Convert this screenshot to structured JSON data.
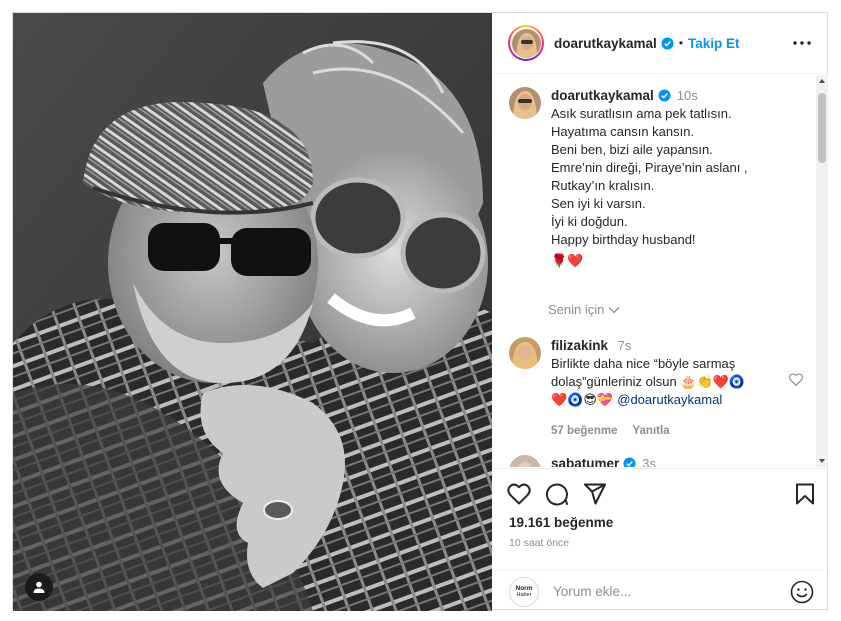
{
  "post": {
    "username": "doarutkaykamal",
    "follow_label": "Takip Et",
    "separator": "•"
  },
  "caption": {
    "username": "doarutkaykamal",
    "time": "10s",
    "lines": [
      "Asık suratlısın ama pek tatlısın.",
      "Hayatıma cansın kansın.",
      "Beni ben, bizi aile yapansın.",
      "Emre’nin direği, Piraye’nin aslanı ,",
      "Rutkay’ın kralısın.",
      "Sen iyi ki varsın.",
      "İyi ki doğdun.",
      "Happy birthday husband!"
    ],
    "emoji_line": "🌹❤️",
    "for_you": "Senin için"
  },
  "comment": {
    "username": "filizakink",
    "time": "7s",
    "text_line1": "Birlikte daha nice “böyle sarmaş",
    "text_line2": "dolaş”günleriniz olsun 🎂👏❤️🧿",
    "text_line3": "❤️🧿😎💝 ",
    "mention": "@doarutkaykamal",
    "likes": "57 beğenme",
    "reply": "Yanıtla"
  },
  "next_comment": {
    "username": "sabatumer",
    "time": "3s"
  },
  "stats": {
    "likes": "19.161 beğenme",
    "ago": "10 saat önce"
  },
  "add_comment": {
    "avatar_line1": "Norm",
    "avatar_line2": "Haber",
    "placeholder": "Yorum ekle..."
  },
  "colors": {
    "accent": "#0095f6",
    "muted": "#8e8e8e",
    "text": "#262626",
    "mention": "#00376b",
    "heart": "#ed4956"
  },
  "icons": [
    "verified-badge-icon",
    "more-options-icon",
    "chevron-down-icon",
    "heart-outline-icon",
    "comment-icon",
    "share-icon",
    "bookmark-icon",
    "smiley-icon",
    "user-tag-icon"
  ]
}
